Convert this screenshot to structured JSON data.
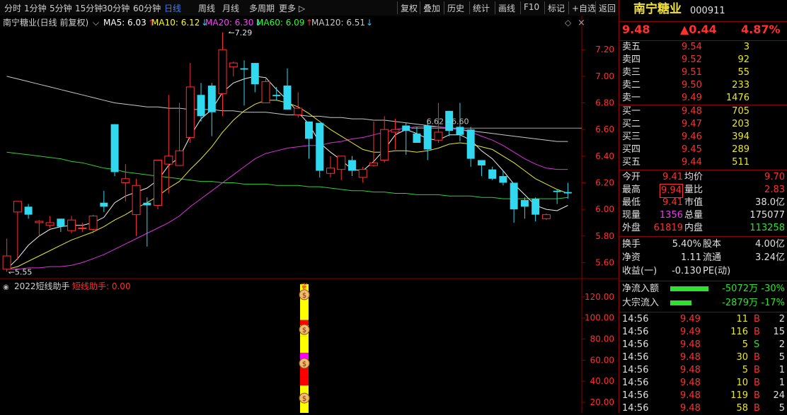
{
  "toolbar": {
    "period_tabs": [
      "分时",
      "1分钟",
      "5分钟",
      "15分钟",
      "30分钟",
      "60分钟",
      "日线",
      "周线",
      "月线",
      "多周期",
      "更多 ▷"
    ],
    "active_tab": "日线",
    "actions": [
      "复权",
      "叠加",
      "历史",
      "统计",
      "画线",
      "F10",
      "标记",
      "+自选",
      "返回"
    ]
  },
  "chart_header": {
    "title": "南宁糖业(日线 前复权)",
    "ma": [
      {
        "label": "MA5: 6.03",
        "arrow": "↑",
        "arrow_color": "#ff3030",
        "color": "#ffffff"
      },
      {
        "label": "MA10: 6.12",
        "arrow": "↓",
        "arrow_color": "#30c8ff",
        "color": "#ffff00"
      },
      {
        "label": "MA20: 6.30",
        "arrow": "↓",
        "arrow_color": "#30c8ff",
        "color": "#ff40ff"
      },
      {
        "label": "MA60: 6.09",
        "arrow": "↑",
        "arrow_color": "#ff3030",
        "color": "#30ff30"
      },
      {
        "label": "MA120: 6.51",
        "arrow": "↓",
        "arrow_color": "#30c8ff",
        "color": "#c8c8c8"
      }
    ]
  },
  "indicator_header": {
    "title": "2022短线助手",
    "value": "短线助手: 0.00"
  },
  "annotations": {
    "high": "7.29",
    "low": "5.55",
    "level": "6.62 - 6.60"
  },
  "chart_data": {
    "type": "candlestick",
    "price_axis": {
      "ticks": [
        "7.20",
        "7.00",
        "6.80",
        "6.60",
        "6.40",
        "6.20",
        "6.00",
        "5.80",
        "5.60"
      ],
      "range": [
        5.48,
        7.35
      ]
    },
    "indicator_axis": {
      "ticks": [
        "120.00",
        "100.00",
        "80.00",
        "60.00",
        "40.00",
        "20.00"
      ],
      "range": [
        10,
        132
      ]
    },
    "candles": [
      [
        5.55,
        5.65,
        5.78,
        5.53
      ],
      [
        5.98,
        6.06,
        6.06,
        5.62
      ],
      [
        6.02,
        5.96,
        6.04,
        5.93
      ],
      [
        5.9,
        5.91,
        5.92,
        5.8
      ],
      [
        5.88,
        5.9,
        5.95,
        5.86
      ],
      [
        5.93,
        5.87,
        5.93,
        5.83
      ],
      [
        5.84,
        5.92,
        5.95,
        5.82
      ],
      [
        5.86,
        5.86,
        5.9,
        5.83
      ],
      [
        5.85,
        5.95,
        5.96,
        5.82
      ],
      [
        6.05,
        6.02,
        6.14,
        5.98
      ],
      [
        6.64,
        6.28,
        6.64,
        6.25
      ],
      [
        6.2,
        6.23,
        6.34,
        6.06
      ],
      [
        5.96,
        6.18,
        6.23,
        5.8
      ],
      [
        6.05,
        6.03,
        6.09,
        5.72
      ],
      [
        6.03,
        6.37,
        6.37,
        6.0
      ],
      [
        6.34,
        6.4,
        6.86,
        6.12
      ],
      [
        6.33,
        6.44,
        6.8,
        6.4
      ],
      [
        6.54,
        6.92,
        7.1,
        6.5
      ],
      [
        6.86,
        6.7,
        6.95,
        6.66
      ],
      [
        6.93,
        6.73,
        6.95,
        6.55
      ],
      [
        6.87,
        7.2,
        7.33,
        6.7
      ],
      [
        7.07,
        7.1,
        7.11,
        7.0
      ],
      [
        7.06,
        7.05,
        7.12,
        6.78
      ],
      [
        7.1,
        6.94,
        7.1,
        6.88
      ],
      [
        6.8,
        6.96,
        6.98,
        6.83
      ],
      [
        6.86,
        6.85,
        6.92,
        6.82
      ],
      [
        6.93,
        6.75,
        7.06,
        6.75
      ],
      [
        6.71,
        6.76,
        6.88,
        6.69
      ],
      [
        6.66,
        6.53,
        6.66,
        6.38
      ],
      [
        6.65,
        6.29,
        6.65,
        6.24
      ],
      [
        6.27,
        6.31,
        6.4,
        6.24
      ],
      [
        6.3,
        6.4,
        6.4,
        6.22
      ],
      [
        6.37,
        6.29,
        6.4,
        6.25
      ],
      [
        6.24,
        6.3,
        6.32,
        6.2
      ],
      [
        6.33,
        6.35,
        6.66,
        6.32
      ],
      [
        6.37,
        6.6,
        6.7,
        6.35
      ],
      [
        6.58,
        6.6,
        6.68,
        6.45
      ],
      [
        6.63,
        6.59,
        6.65,
        6.41
      ],
      [
        6.57,
        6.5,
        6.62,
        6.53
      ],
      [
        6.63,
        6.45,
        6.66,
        6.37
      ],
      [
        6.52,
        6.58,
        6.8,
        6.5
      ],
      [
        6.74,
        6.59,
        6.74,
        6.55
      ],
      [
        6.62,
        6.56,
        6.8,
        6.51
      ],
      [
        6.6,
        6.38,
        6.62,
        6.32
      ],
      [
        6.37,
        6.33,
        6.37,
        6.25
      ],
      [
        6.3,
        6.23,
        6.32,
        6.22
      ],
      [
        6.25,
        6.2,
        6.29,
        6.18
      ],
      [
        6.2,
        6.0,
        6.2,
        5.9
      ],
      [
        6.07,
        6.02,
        6.09,
        5.93
      ],
      [
        6.08,
        5.96,
        6.09,
        5.91
      ],
      [
        5.93,
        5.96,
        5.97,
        5.92
      ],
      [
        6.14,
        6.13,
        6.15,
        6.04
      ],
      [
        6.13,
        6.12,
        6.2,
        6.08
      ]
    ],
    "ma5": [
      5.55,
      5.63,
      5.73,
      5.8,
      5.85,
      5.87,
      5.88,
      5.88,
      5.9,
      5.94,
      6.05,
      6.1,
      6.13,
      6.16,
      6.22,
      6.33,
      6.39,
      6.55,
      6.68,
      6.75,
      6.88,
      6.95,
      6.98,
      7.0,
      6.99,
      6.9,
      6.82,
      6.73,
      6.64,
      6.5,
      6.43,
      6.37,
      6.3,
      6.29,
      6.36,
      6.45,
      6.56,
      6.6,
      6.57,
      6.53,
      6.52,
      6.56,
      6.56,
      6.52,
      6.44,
      6.38,
      6.29,
      6.19,
      6.11,
      6.03,
      6.0,
      5.99,
      6.03
    ],
    "ma10": [
      5.55,
      5.57,
      5.61,
      5.65,
      5.69,
      5.73,
      5.77,
      5.8,
      5.83,
      5.87,
      5.92,
      5.96,
      6.01,
      6.05,
      6.1,
      6.16,
      6.21,
      6.3,
      6.38,
      6.47,
      6.58,
      6.67,
      6.74,
      6.79,
      6.82,
      6.82,
      6.8,
      6.77,
      6.72,
      6.66,
      6.6,
      6.55,
      6.5,
      6.45,
      6.43,
      6.43,
      6.44,
      6.44,
      6.43,
      6.44,
      6.46,
      6.49,
      6.5,
      6.49,
      6.47,
      6.45,
      6.4,
      6.35,
      6.29,
      6.23,
      6.19,
      6.15,
      6.12
    ],
    "ma20": [
      5.55,
      5.55,
      5.56,
      5.56,
      5.57,
      5.57,
      5.58,
      5.6,
      5.63,
      5.66,
      5.7,
      5.74,
      5.78,
      5.82,
      5.86,
      5.9,
      5.95,
      6.02,
      6.08,
      6.14,
      6.2,
      6.26,
      6.32,
      6.38,
      6.42,
      6.44,
      6.46,
      6.47,
      6.48,
      6.48,
      6.5,
      6.51,
      6.53,
      6.54,
      6.56,
      6.58,
      6.6,
      6.61,
      6.62,
      6.62,
      6.62,
      6.61,
      6.6,
      6.58,
      6.55,
      6.52,
      6.48,
      6.43,
      6.38,
      6.34,
      6.31,
      6.3,
      6.3
    ],
    "ma60": [
      6.43,
      6.42,
      6.41,
      6.4,
      6.39,
      6.38,
      6.36,
      6.35,
      6.33,
      6.31,
      6.3,
      6.28,
      6.27,
      6.26,
      6.25,
      6.24,
      6.23,
      6.22,
      6.21,
      6.21,
      6.2,
      6.2,
      6.19,
      6.19,
      6.19,
      6.18,
      6.18,
      6.18,
      6.17,
      6.17,
      6.16,
      6.15,
      6.14,
      6.14,
      6.13,
      6.13,
      6.12,
      6.12,
      6.11,
      6.11,
      6.11,
      6.1,
      6.1,
      6.1,
      6.09,
      6.09,
      6.08,
      6.08,
      6.08,
      6.08,
      6.08,
      6.08,
      6.09
    ],
    "ma120": [
      7.0,
      6.98,
      6.96,
      6.94,
      6.92,
      6.9,
      6.88,
      6.86,
      6.84,
      6.82,
      6.8,
      6.79,
      6.78,
      6.77,
      6.77,
      6.76,
      6.76,
      6.75,
      6.75,
      6.75,
      6.74,
      6.74,
      6.73,
      6.73,
      6.73,
      6.72,
      6.71,
      6.71,
      6.7,
      6.7,
      6.69,
      6.69,
      6.68,
      6.68,
      6.67,
      6.67,
      6.66,
      6.65,
      6.64,
      6.63,
      6.62,
      6.61,
      6.6,
      6.59,
      6.58,
      6.57,
      6.56,
      6.55,
      6.54,
      6.53,
      6.52,
      6.51,
      6.51
    ],
    "signal_bar": {
      "segments": [
        {
          "from": 132,
          "to": 122,
          "color": "#ffff00"
        },
        {
          "from": 122,
          "to": 98,
          "color": "#ffff00"
        },
        {
          "from": 98,
          "to": 93,
          "color": "#ff0000"
        },
        {
          "from": 93,
          "to": 83,
          "color": "#ffff00"
        },
        {
          "from": 83,
          "to": 67,
          "color": "#ffff00"
        },
        {
          "from": 67,
          "to": 57,
          "color": "#ff00ff"
        },
        {
          "from": 57,
          "to": 44,
          "color": "#ff0000"
        },
        {
          "from": 44,
          "to": 36,
          "color": "#ff0000"
        },
        {
          "from": 36,
          "to": 10,
          "color": "#ffff00"
        }
      ],
      "icon_levels": [
        122,
        89,
        57,
        24
      ],
      "icon_glyph": "$",
      "top_icon_glyph": "❦"
    }
  },
  "quote": {
    "name": "南宁糖业",
    "code": "000911",
    "price": "9.48",
    "change": "▲0.44",
    "pct": "4.87%",
    "asks": [
      [
        "卖五",
        "9.54",
        "3"
      ],
      [
        "卖四",
        "9.52",
        "92"
      ],
      [
        "卖三",
        "9.51",
        "55"
      ],
      [
        "卖二",
        "9.50",
        "233"
      ],
      [
        "卖一",
        "9.49",
        "1476"
      ]
    ],
    "bids": [
      [
        "买一",
        "9.48",
        "705"
      ],
      [
        "买二",
        "9.47",
        "203"
      ],
      [
        "买三",
        "9.46",
        "394"
      ],
      [
        "买四",
        "9.45",
        "289"
      ],
      [
        "买五",
        "9.44",
        "511"
      ]
    ],
    "stats": [
      [
        "今开",
        "9.41",
        "均价",
        "9.70"
      ],
      [
        "最高",
        "9.94",
        "量比",
        "2.83"
      ],
      [
        "最低",
        "9.41",
        "市值",
        "38.0亿"
      ],
      [
        "现量",
        "1356",
        "总量",
        "175077"
      ],
      [
        "外盘",
        "61819",
        "内盘",
        "113258"
      ]
    ],
    "fundamentals": [
      [
        "换手",
        "5.40%",
        "股本",
        "4.00亿"
      ],
      [
        "净资",
        "1.11",
        "流通",
        "3.24亿"
      ],
      [
        "收益(一)",
        "-0.130",
        "PE(动)",
        ""
      ]
    ],
    "flows": [
      [
        "净流入额",
        "-5072万",
        "-30%"
      ],
      [
        "大宗流入",
        "-2879万",
        "-17%"
      ]
    ],
    "ticks": [
      [
        "14:56",
        "9.49",
        "11",
        "B",
        "2"
      ],
      [
        "14:56",
        "9.49",
        "116",
        "B",
        "15"
      ],
      [
        "14:56",
        "9.48",
        "5",
        "S",
        "2"
      ],
      [
        "14:56",
        "9.48",
        "30",
        "B",
        "5"
      ],
      [
        "14:56",
        "9.48",
        "5",
        "B",
        "1"
      ],
      [
        "14:56",
        "9.48",
        "10",
        "B",
        "1"
      ],
      [
        "14:56",
        "9.48",
        "119",
        "B",
        "24"
      ],
      [
        "14:56",
        "9.48",
        "58",
        "B",
        "5"
      ]
    ]
  }
}
